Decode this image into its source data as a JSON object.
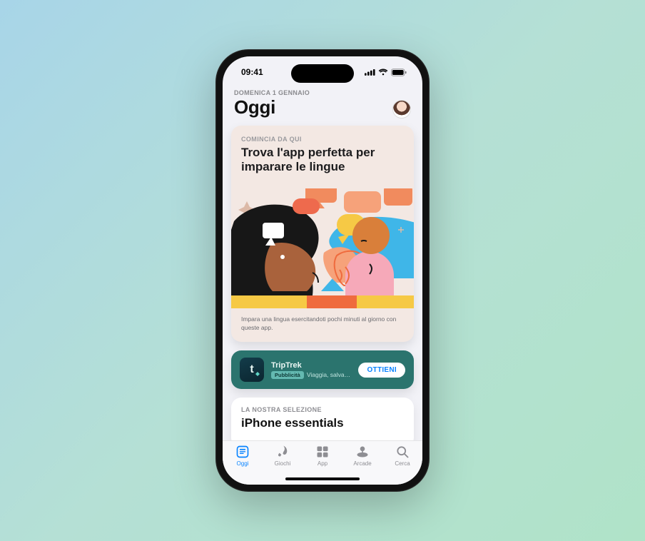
{
  "status": {
    "time": "09:41"
  },
  "header": {
    "date": "DOMENICA 1 GENNAIO",
    "title": "Oggi"
  },
  "feature": {
    "eyebrow": "COMINCIA DA QUI",
    "title": "Trova l'app perfetta per imparare le lingue",
    "footer": "Impara una lingua esercitandoti pochi minuti al giorno con queste app."
  },
  "promo": {
    "app_name": "TripTrek",
    "ad_label": "Pubblicità",
    "subtitle": "Viaggia, salva e…",
    "button": "OTTIENI",
    "icon_letter": "t"
  },
  "selection": {
    "eyebrow": "LA NOSTRA SELEZIONE",
    "title": "iPhone essentials"
  },
  "tabs": {
    "today": "Oggi",
    "games": "Giochi",
    "apps": "App",
    "arcade": "Arcade",
    "search": "Cerca"
  }
}
